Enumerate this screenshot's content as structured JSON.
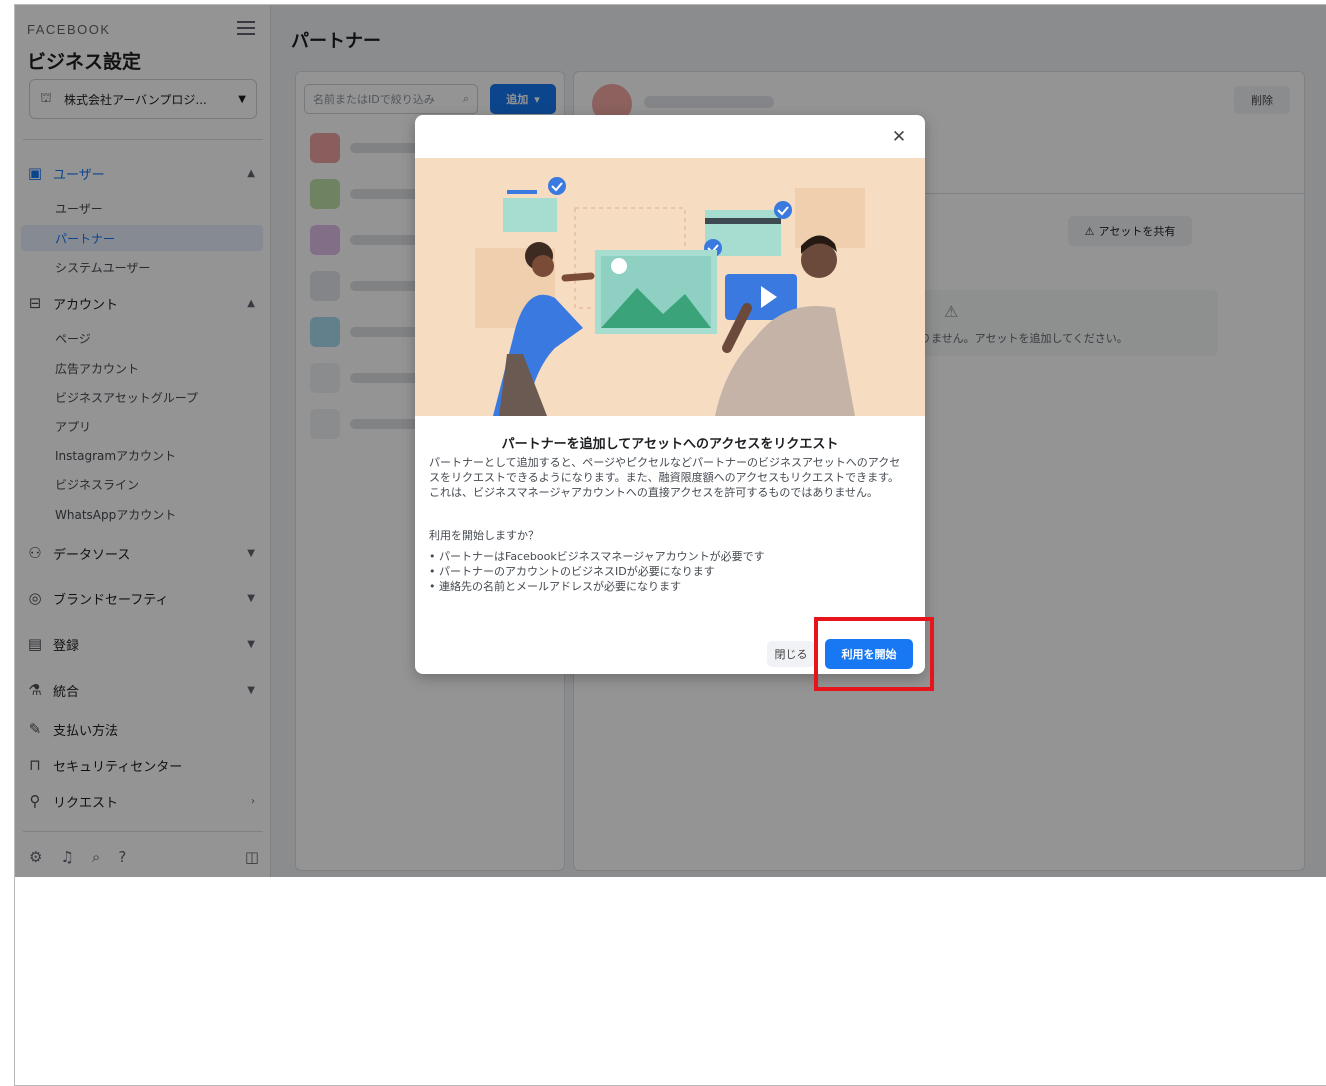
{
  "sidebar": {
    "brand": "FACEBOOK",
    "title": "ビジネス設定",
    "business_name": "株式会社アーバンプロジ...",
    "sections": {
      "users": "ユーザー",
      "accounts": "アカウント",
      "data_sources": "データソース",
      "brand_safety": "ブランドセーフティ",
      "registration": "登録",
      "integrations": "統合",
      "payment": "支払い方法",
      "security": "セキュリティセンター",
      "requests": "リクエスト"
    },
    "user_items": [
      "ユーザー",
      "パートナー",
      "システムユーザー"
    ],
    "account_items": [
      "ページ",
      "広告アカウント",
      "ビジネスアセットグループ",
      "アプリ",
      "Instagramアカウント",
      "ビジネスライン",
      "WhatsAppアカウント"
    ]
  },
  "main": {
    "page_title": "パートナー",
    "search_placeholder": "名前またはIDで絞り込み",
    "add_label": "追加",
    "remove_label": "削除",
    "share_assets_label": "アセットを共有",
    "empty_text": "りません。アセットを追加してください。"
  },
  "modal": {
    "title": "パートナーを追加してアセットへのアクセスをリクエスト",
    "body": "パートナーとして追加すると、ページやピクセルなどパートナーのビジネスアセットへのアクセスをリクエストできるようになります。また、融資限度額へのアクセスもリクエストできます。これは、ビジネスマネージャアカウントへの直接アクセスを許可するものではありません。",
    "question": "利用を開始しますか？",
    "requirements": [
      "パートナーはFacebookビジネスマネージャアカウントが必要です",
      "パートナーのアカウントのビジネスIDが必要になります",
      "連絡先の名前とメールアドレスが必要になります"
    ],
    "close_label": "閉じる",
    "start_label": "利用を開始"
  },
  "colors": {
    "accent": "#1877f2",
    "highlight": "#e8141b",
    "illustration_bg": "#f6dcc1"
  }
}
